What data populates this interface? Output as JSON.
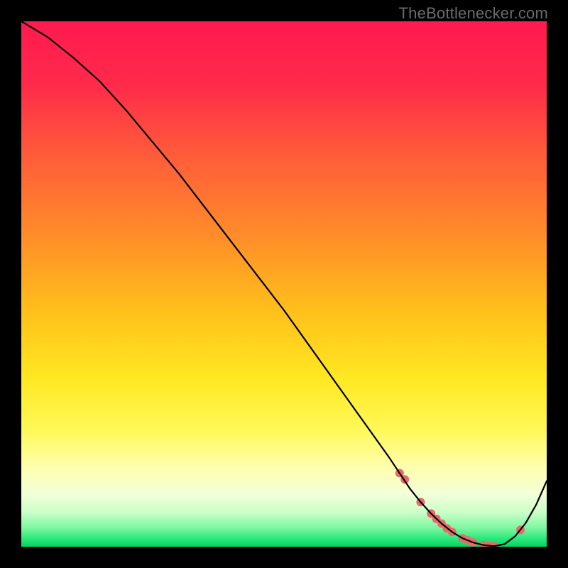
{
  "watermark": "TheBottlenecker.com",
  "chart_data": {
    "type": "line",
    "title": "",
    "xlabel": "",
    "ylabel": "",
    "xlim": [
      0,
      100
    ],
    "ylim": [
      0,
      100
    ],
    "grid": false,
    "legend": false,
    "background_gradient": {
      "stops": [
        {
          "offset": 0.0,
          "color": "#ff1a4f"
        },
        {
          "offset": 0.12,
          "color": "#ff2a4a"
        },
        {
          "offset": 0.25,
          "color": "#ff5a3a"
        },
        {
          "offset": 0.4,
          "color": "#ff8a2a"
        },
        {
          "offset": 0.55,
          "color": "#ffbf1a"
        },
        {
          "offset": 0.68,
          "color": "#ffe822"
        },
        {
          "offset": 0.78,
          "color": "#fff95a"
        },
        {
          "offset": 0.85,
          "color": "#ffffb0"
        },
        {
          "offset": 0.9,
          "color": "#f2ffd8"
        },
        {
          "offset": 0.935,
          "color": "#caffc8"
        },
        {
          "offset": 0.965,
          "color": "#7af7a0"
        },
        {
          "offset": 0.985,
          "color": "#29e87a"
        },
        {
          "offset": 1.0,
          "color": "#00d564"
        }
      ]
    },
    "series": [
      {
        "name": "bottleneck-curve",
        "x": [
          0,
          5,
          10,
          15,
          20,
          25,
          30,
          35,
          40,
          45,
          50,
          55,
          60,
          65,
          70,
          72,
          74,
          76,
          78,
          80,
          82,
          84,
          86,
          88,
          90,
          92,
          94,
          96,
          98,
          100
        ],
        "values": [
          100,
          97,
          93,
          88.5,
          83,
          77,
          71,
          64.5,
          58,
          51.5,
          45,
          38,
          31,
          24,
          17,
          14,
          11,
          8.5,
          6.3,
          4.4,
          2.8,
          1.6,
          0.8,
          0.3,
          0.1,
          0.5,
          2.0,
          4.5,
          8.0,
          12.5
        ]
      }
    ],
    "markers": {
      "name": "highlight-dots",
      "color": "#e86a6a",
      "radius": 6,
      "x": [
        72,
        73,
        76,
        78,
        79,
        80,
        81,
        82,
        84,
        85,
        86,
        88,
        89,
        90,
        95
      ],
      "values": [
        14.0,
        12.8,
        8.5,
        6.3,
        5.3,
        4.4,
        3.5,
        2.8,
        1.6,
        1.2,
        0.8,
        0.3,
        0.2,
        0.1,
        3.2
      ]
    }
  }
}
